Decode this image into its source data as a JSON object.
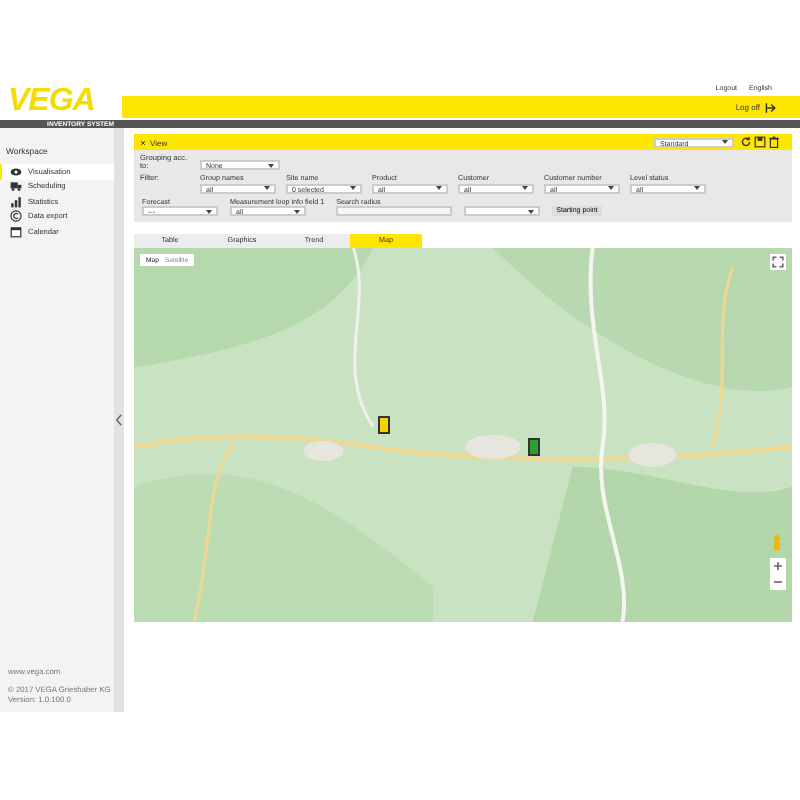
{
  "header": {
    "logo": "VEGA",
    "subtitle": "INVENTORY SYSTEM",
    "top_links": [
      "Logout",
      "English"
    ],
    "log_off": "Log off"
  },
  "sidebar": {
    "title": "Workspace",
    "items": [
      {
        "label": "Visualisation",
        "selected": true
      },
      {
        "label": "Scheduling",
        "selected": false
      },
      {
        "label": "Statistics",
        "selected": false
      },
      {
        "label": "Data export",
        "selected": false
      },
      {
        "label": "Calendar",
        "selected": false
      }
    ],
    "footer": [
      "www.vega.com",
      "© 2017 VEGA Grieshaber KG",
      "Version: 1.0.100.0"
    ]
  },
  "view": {
    "title": "View",
    "preset": "Standard",
    "grouping": {
      "label": "Grouping acc. to:",
      "value": "None"
    },
    "filter_label": "Filter:",
    "filters": [
      {
        "label": "Group names",
        "value": "all"
      },
      {
        "label": "Site name",
        "value": "0 selected"
      },
      {
        "label": "Product",
        "value": "all"
      },
      {
        "label": "Customer",
        "value": "all"
      },
      {
        "label": "Customer number",
        "value": "all"
      },
      {
        "label": "Level status",
        "value": "all"
      }
    ],
    "forecast": {
      "label": "Forecast",
      "value": "---"
    },
    "loop_info": {
      "label": "Measurement loop info field 1",
      "value": "all"
    },
    "search_radius": {
      "label": "Search radius"
    },
    "starting_point": "Starting point"
  },
  "tabs": [
    {
      "label": "Table",
      "selected": false
    },
    {
      "label": "Graphics",
      "selected": false
    },
    {
      "label": "Trend",
      "selected": false
    },
    {
      "label": "Map",
      "selected": true
    }
  ],
  "map": {
    "modes": [
      {
        "label": "Map",
        "selected": true
      },
      {
        "label": "Satellite",
        "selected": false
      }
    ],
    "markers": [
      {
        "color": "#f2d200"
      },
      {
        "color": "#2e9e2e"
      }
    ]
  }
}
